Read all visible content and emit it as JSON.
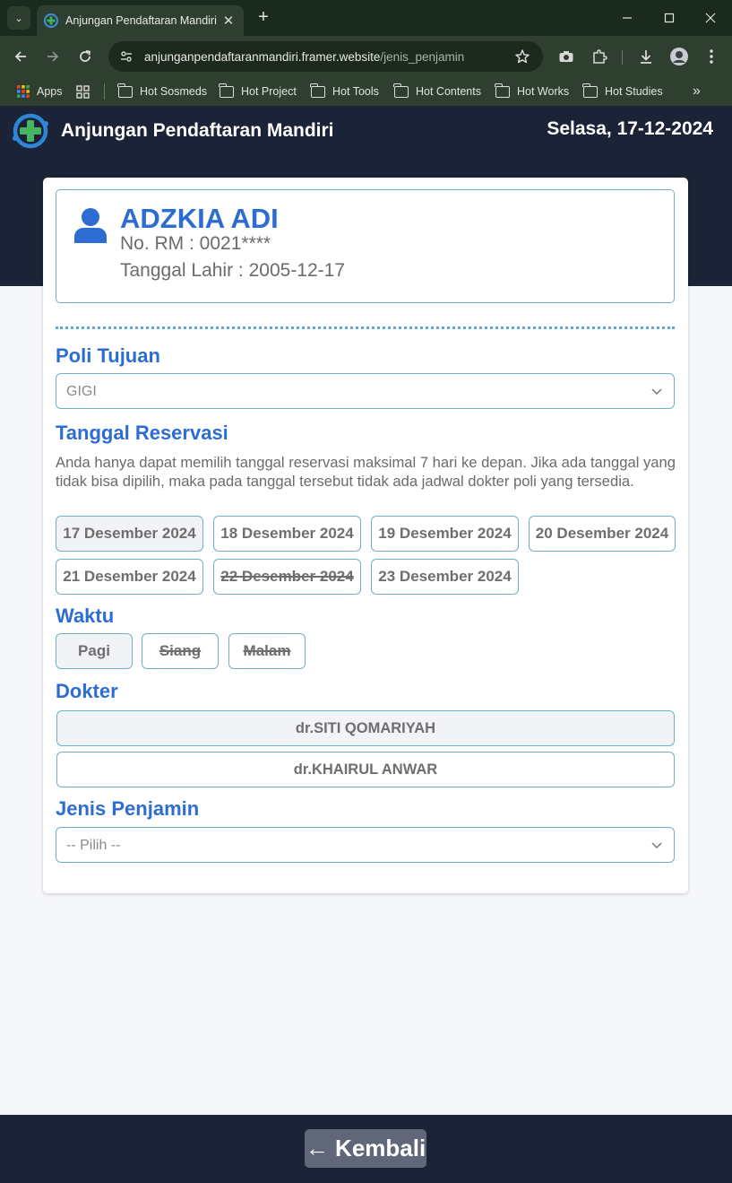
{
  "browser": {
    "tab_title": "Anjungan Pendaftaran Mandiri",
    "url_host": "anjunganpendaftaranmandiri.framer.website",
    "url_path": "/jenis_penjamin",
    "bookmarks": [
      "Apps",
      "Hot Sosmeds",
      "Hot Project",
      "Hot Tools",
      "Hot Contents",
      "Hot Works",
      "Hot Studies"
    ],
    "more_bookmarks": "»"
  },
  "header": {
    "app_title": "Anjungan Pendaftaran Mandiri",
    "date": "Selasa, 17-12-2024"
  },
  "patient": {
    "name": "ADZKIA ADI",
    "rm": "No. RM : 0021****",
    "dob": "Tanggal Lahir : 2005-12-17"
  },
  "poli": {
    "label": "Poli Tujuan",
    "value": "GIGI"
  },
  "reservasi": {
    "label": "Tanggal Reservasi",
    "description": "Anda hanya dapat memilih tanggal reservasi maksimal 7 hari ke depan. Jika ada tanggal yang tidak bisa dipilih, maka pada tanggal tersebut tidak ada jadwal dokter poli yang tersedia.",
    "dates": [
      {
        "label": "17 Desember 2024",
        "state": "selected"
      },
      {
        "label": "18 Desember 2024",
        "state": "available"
      },
      {
        "label": "19 Desember 2024",
        "state": "available"
      },
      {
        "label": "20 Desember 2024",
        "state": "available"
      },
      {
        "label": "21 Desember 2024",
        "state": "available"
      },
      {
        "label": "22 Desember 2024",
        "state": "unavailable"
      },
      {
        "label": "23 Desember 2024",
        "state": "available"
      }
    ]
  },
  "waktu": {
    "label": "Waktu",
    "options": [
      {
        "label": "Pagi",
        "state": "selected"
      },
      {
        "label": "Siang",
        "state": "unavailable"
      },
      {
        "label": "Malam",
        "state": "unavailable"
      }
    ]
  },
  "dokter": {
    "label": "Dokter",
    "options": [
      {
        "label": "dr.SITI QOMARIYAH",
        "state": "selected"
      },
      {
        "label": "dr.KHAIRUL ANWAR",
        "state": "available"
      }
    ]
  },
  "penjamin": {
    "label": "Jenis Penjamin",
    "placeholder": "-- Pilih --"
  },
  "footer": {
    "back_label": "← Kembali"
  },
  "colors": {
    "accent": "#2d6dd2",
    "border": "#6fb0c9",
    "header_bg": "#1a2436",
    "selected_bg": "#f1f3f7"
  }
}
